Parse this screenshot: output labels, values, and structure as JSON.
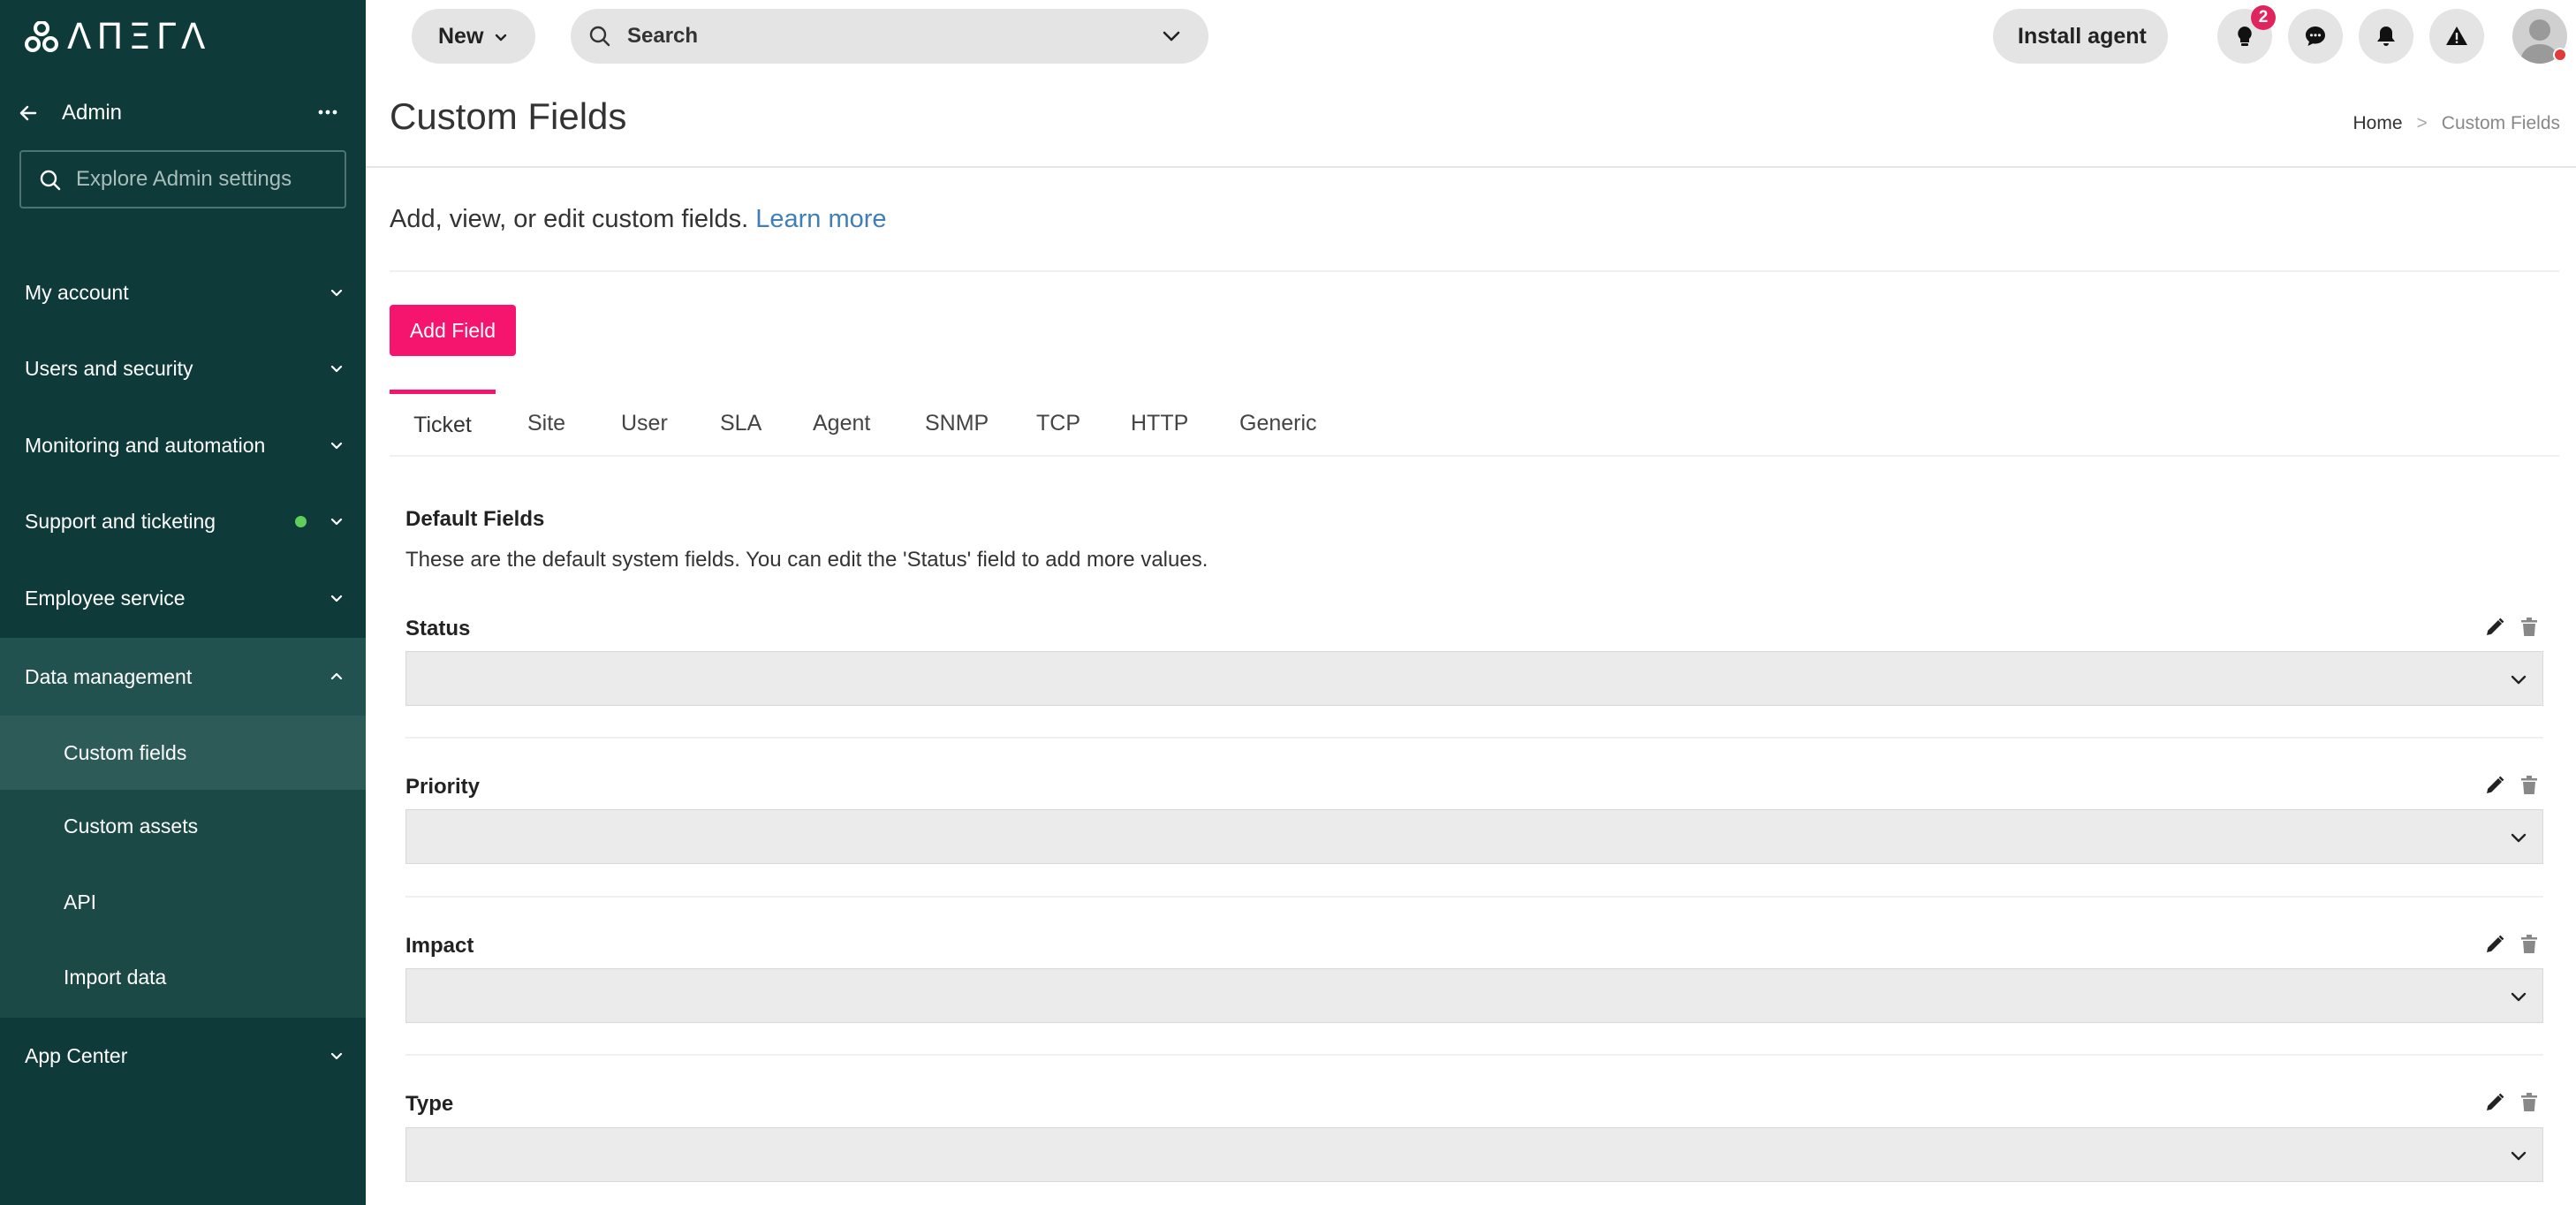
{
  "sidebar": {
    "brand": "ΛΠΞΓΛ",
    "admin_title": "Admin",
    "search_placeholder": "Explore Admin settings",
    "items": [
      {
        "label": "My account"
      },
      {
        "label": "Users and security"
      },
      {
        "label": "Monitoring and automation"
      },
      {
        "label": "Support and ticketing"
      },
      {
        "label": "Employee service"
      },
      {
        "label": "Data management"
      },
      {
        "label": "App Center"
      }
    ],
    "sub_items": [
      {
        "label": "Custom fields"
      },
      {
        "label": "Custom assets"
      },
      {
        "label": "API"
      },
      {
        "label": "Import data"
      }
    ]
  },
  "topbar": {
    "new_label": "New",
    "search_label": "Search",
    "install_label": "Install agent",
    "notifications_badge": "2"
  },
  "page": {
    "title": "Custom Fields",
    "breadcrumb_home": "Home",
    "breadcrumb_sep": ">",
    "breadcrumb_current": "Custom Fields",
    "intro_text": "Add, view, or edit custom fields. ",
    "intro_link": "Learn more",
    "add_field_label": "Add Field"
  },
  "tabs": [
    {
      "label": "Ticket"
    },
    {
      "label": "Site"
    },
    {
      "label": "User"
    },
    {
      "label": "SLA"
    },
    {
      "label": "Agent"
    },
    {
      "label": "SNMP"
    },
    {
      "label": "TCP"
    },
    {
      "label": "HTTP"
    },
    {
      "label": "Generic"
    }
  ],
  "default_fields": {
    "title": "Default Fields",
    "description": "These are the default system fields. You can edit the 'Status' field to add more values.",
    "fields": [
      {
        "label": "Status"
      },
      {
        "label": "Priority"
      },
      {
        "label": "Impact"
      },
      {
        "label": "Type"
      }
    ]
  },
  "colors": {
    "sidebar_bg": "#0e3b39",
    "accent": "#f5146e",
    "link": "#3f7fb5"
  }
}
